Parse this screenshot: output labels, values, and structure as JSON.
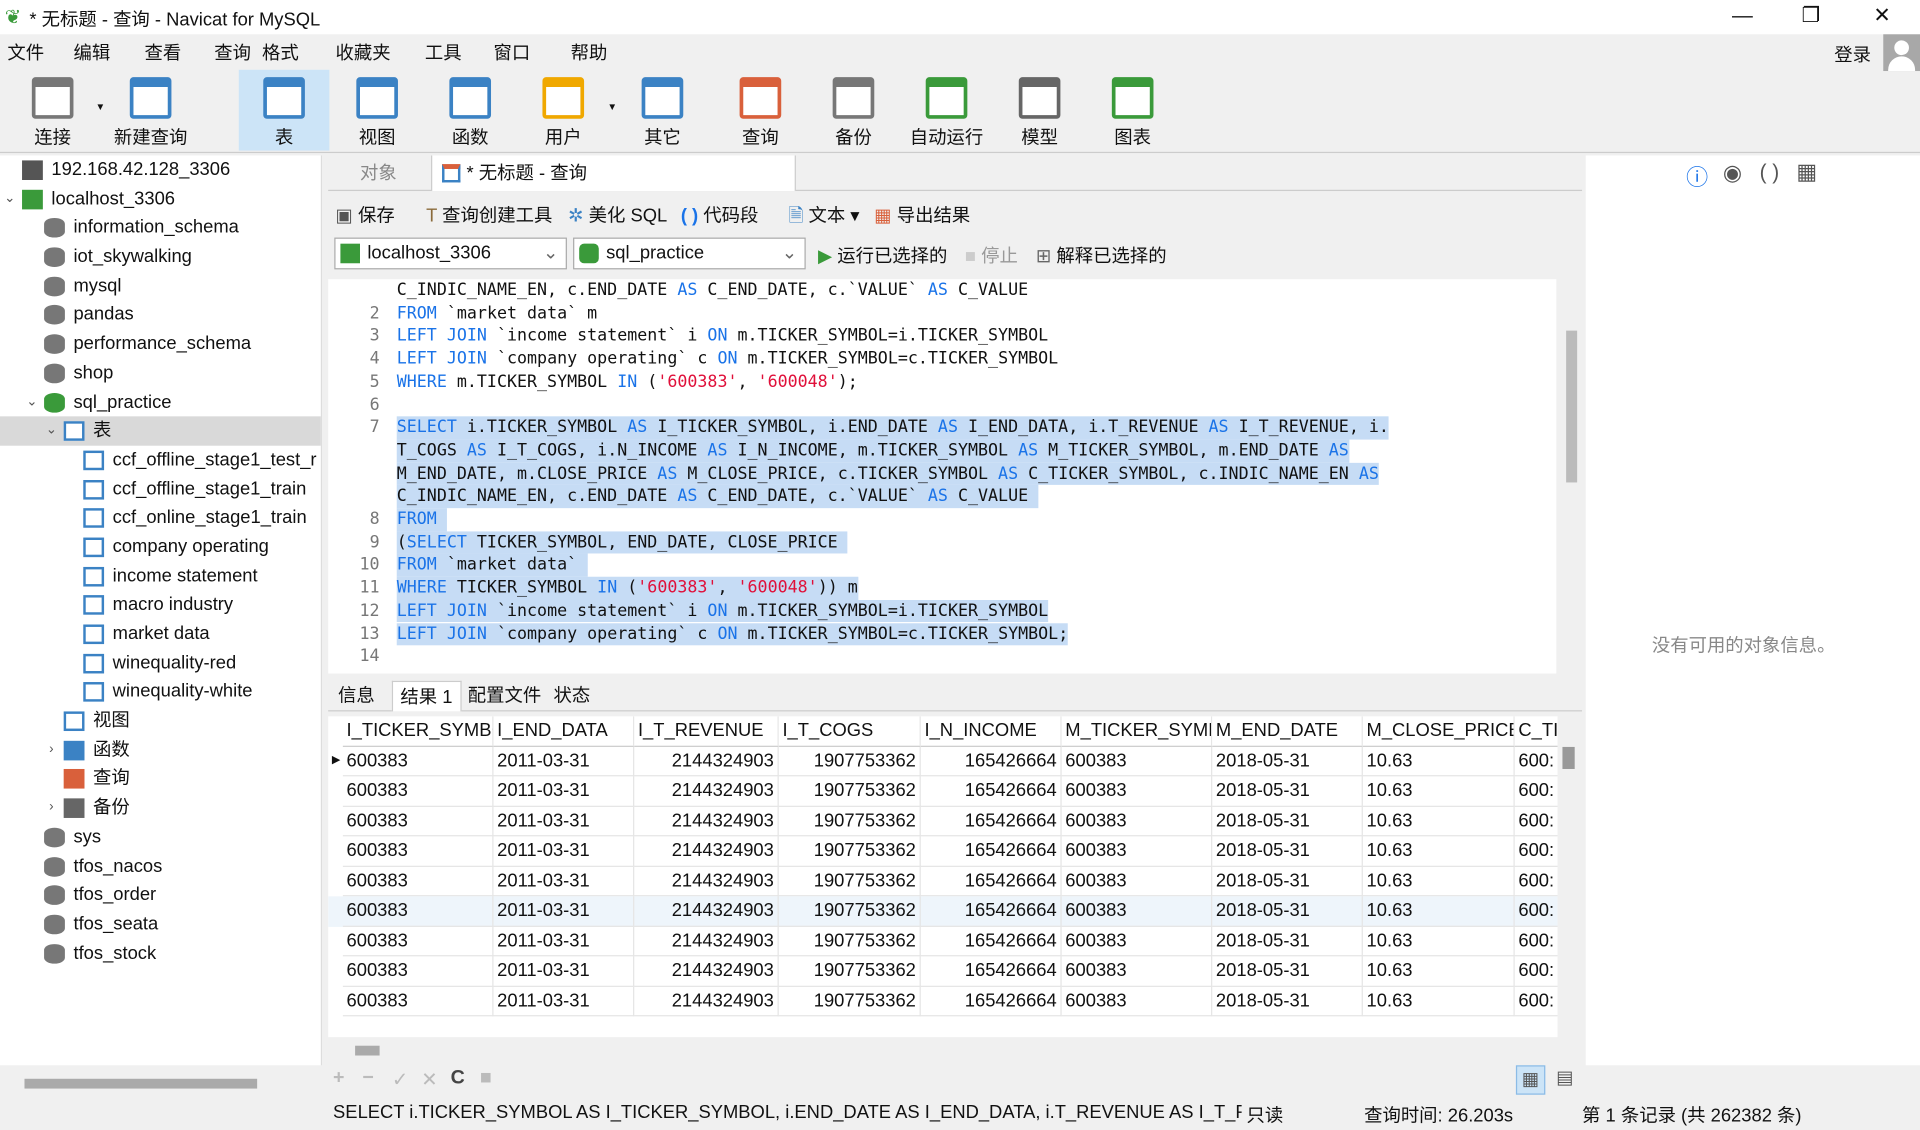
{
  "window": {
    "title": "* 无标题 - 查询 - Navicat for MySQL",
    "minimize": "—",
    "restore": "❐",
    "close": "✕"
  },
  "menu": [
    "文件",
    "编辑",
    "查看",
    "查询",
    "格式",
    "收藏夹",
    "工具",
    "窗口",
    "帮助"
  ],
  "login": "登录",
  "toolbar": [
    {
      "label": "连接",
      "icon": "plug-icon",
      "color": "#777"
    },
    {
      "label": "新建查询",
      "icon": "new-query-icon",
      "color": "#3b82c4"
    },
    {
      "label": "表",
      "icon": "table-icon",
      "color": "#3b82c4",
      "active": true
    },
    {
      "label": "视图",
      "icon": "view-icon",
      "color": "#3b82c4"
    },
    {
      "label": "函数",
      "icon": "function-icon",
      "color": "#3b82c4"
    },
    {
      "label": "用户",
      "icon": "user-icon",
      "color": "#f0a800"
    },
    {
      "label": "其它",
      "icon": "tools-icon",
      "color": "#3b82c4"
    },
    {
      "label": "查询",
      "icon": "query-icon",
      "color": "#d9603b"
    },
    {
      "label": "备份",
      "icon": "backup-icon",
      "color": "#777"
    },
    {
      "label": "自动运行",
      "icon": "schedule-icon",
      "color": "#3a9a3a"
    },
    {
      "label": "模型",
      "icon": "model-icon",
      "color": "#666"
    },
    {
      "label": "图表",
      "icon": "chart-icon",
      "color": "#3a9a3a"
    }
  ],
  "tree": [
    {
      "label": "192.168.42.128_3306",
      "level": 0,
      "icon": "server-icon",
      "arrow": ""
    },
    {
      "label": "localhost_3306",
      "level": 0,
      "icon": "server-connected-icon",
      "arrow": "v"
    },
    {
      "label": "information_schema",
      "level": 1,
      "icon": "database-icon"
    },
    {
      "label": "iot_skywalking",
      "level": 1,
      "icon": "database-icon"
    },
    {
      "label": "mysql",
      "level": 1,
      "icon": "database-icon"
    },
    {
      "label": "pandas",
      "level": 1,
      "icon": "database-icon"
    },
    {
      "label": "performance_schema",
      "level": 1,
      "icon": "database-icon"
    },
    {
      "label": "shop",
      "level": 1,
      "icon": "database-icon"
    },
    {
      "label": "sql_practice",
      "level": 1,
      "icon": "database-open-icon",
      "arrow": "v"
    },
    {
      "label": "表",
      "level": 2,
      "icon": "table-icon",
      "arrow": "v",
      "selected": true
    },
    {
      "label": "ccf_offline_stage1_test_r",
      "level": 3,
      "icon": "table-icon"
    },
    {
      "label": "ccf_offline_stage1_train",
      "level": 3,
      "icon": "table-icon"
    },
    {
      "label": "ccf_online_stage1_train",
      "level": 3,
      "icon": "table-icon"
    },
    {
      "label": "company operating",
      "level": 3,
      "icon": "table-icon"
    },
    {
      "label": "income statement",
      "level": 3,
      "icon": "table-icon"
    },
    {
      "label": "macro industry",
      "level": 3,
      "icon": "table-icon"
    },
    {
      "label": "market data",
      "level": 3,
      "icon": "table-icon"
    },
    {
      "label": "winequality-red",
      "level": 3,
      "icon": "table-icon"
    },
    {
      "label": "winequality-white",
      "level": 3,
      "icon": "table-icon"
    },
    {
      "label": "视图",
      "level": 2,
      "icon": "view-icon"
    },
    {
      "label": "函数",
      "level": 2,
      "icon": "function-icon",
      "arrow": ">"
    },
    {
      "label": "查询",
      "level": 2,
      "icon": "query-icon"
    },
    {
      "label": "备份",
      "level": 2,
      "icon": "backup-icon",
      "arrow": ">"
    },
    {
      "label": "sys",
      "level": 1,
      "icon": "database-icon"
    },
    {
      "label": "tfos_nacos",
      "level": 1,
      "icon": "database-icon"
    },
    {
      "label": "tfos_order",
      "level": 1,
      "icon": "database-icon"
    },
    {
      "label": "tfos_seata",
      "level": 1,
      "icon": "database-icon"
    },
    {
      "label": "tfos_stock",
      "level": 1,
      "icon": "database-icon"
    }
  ],
  "tabs": {
    "objects": "对象",
    "query": "* 无标题 - 查询"
  },
  "query_toolbar": {
    "save": "保存",
    "builder": "查询创建工具",
    "beautify": "美化 SQL",
    "snippet": "代码段",
    "text": "文本",
    "export": "导出结果"
  },
  "selectors": {
    "connection": "localhost_3306",
    "database": "sql_practice",
    "run_selected": "运行已选择的",
    "stop": "停止",
    "explain": "解释已选择的"
  },
  "editor": [
    {
      "n": "",
      "s": false,
      "tk": [
        [
          "C_INDIC_NAME_EN, c.END_DATE ",
          ""
        ],
        [
          "AS",
          "kw"
        ],
        [
          " C_END_DATE, c.`VALUE` ",
          ""
        ],
        [
          "AS",
          "kw"
        ],
        [
          " C_VALUE",
          ""
        ]
      ]
    },
    {
      "n": "2",
      "s": false,
      "tk": [
        [
          "FROM",
          "kw"
        ],
        [
          " `market data` m",
          ""
        ]
      ]
    },
    {
      "n": "3",
      "s": false,
      "tk": [
        [
          "LEFT JOIN",
          "kw"
        ],
        [
          " `income statement` i ",
          ""
        ],
        [
          "ON",
          "kw"
        ],
        [
          " m.TICKER_SYMBOL=i.TICKER_SYMBOL",
          ""
        ]
      ]
    },
    {
      "n": "4",
      "s": false,
      "tk": [
        [
          "LEFT JOIN",
          "kw"
        ],
        [
          " `company operating` c ",
          ""
        ],
        [
          "ON",
          "kw"
        ],
        [
          " m.TICKER_SYMBOL=c.TICKER_SYMBOL",
          ""
        ]
      ]
    },
    {
      "n": "5",
      "s": false,
      "tk": [
        [
          "WHERE",
          "kw"
        ],
        [
          " m.TICKER_SYMBOL ",
          ""
        ],
        [
          "IN",
          "kw"
        ],
        [
          " (",
          ""
        ],
        [
          "'600383'",
          "str"
        ],
        [
          ", ",
          ""
        ],
        [
          "'600048'",
          "str"
        ],
        [
          ");",
          ""
        ]
      ]
    },
    {
      "n": "6",
      "s": false,
      "tk": []
    },
    {
      "n": "7",
      "s": true,
      "tk": [
        [
          "SELECT",
          "kw"
        ],
        [
          " i.TICKER_SYMBOL ",
          ""
        ],
        [
          "AS",
          "kw"
        ],
        [
          " I_TICKER_SYMBOL, i.END_DATE ",
          ""
        ],
        [
          "AS",
          "kw"
        ],
        [
          " I_END_DATA, i.T_REVENUE ",
          ""
        ],
        [
          "AS",
          "kw"
        ],
        [
          " I_T_REVENUE, i.",
          ""
        ]
      ]
    },
    {
      "n": "",
      "s": true,
      "tk": [
        [
          "T_COGS ",
          ""
        ],
        [
          "AS",
          "kw"
        ],
        [
          " I_T_COGS, i.N_INCOME ",
          ""
        ],
        [
          "AS",
          "kw"
        ],
        [
          " I_N_INCOME, m.TICKER_SYMBOL ",
          ""
        ],
        [
          "AS",
          "kw"
        ],
        [
          " M_TICKER_SYMBOL, m.END_DATE ",
          ""
        ],
        [
          "AS",
          "kw"
        ]
      ]
    },
    {
      "n": "",
      "s": true,
      "tk": [
        [
          "M_END_DATE, m.CLOSE_PRICE ",
          ""
        ],
        [
          "AS",
          "kw"
        ],
        [
          " M_CLOSE_PRICE, c.TICKER_SYMBOL ",
          ""
        ],
        [
          "AS",
          "kw"
        ],
        [
          " C_TICKER_SYMBOL, c.INDIC_NAME_EN ",
          ""
        ],
        [
          "AS",
          "kw"
        ]
      ]
    },
    {
      "n": "",
      "s": true,
      "tk": [
        [
          "C_INDIC_NAME_EN, c.END_DATE ",
          ""
        ],
        [
          "AS",
          "kw"
        ],
        [
          " C_END_DATE, c.`VALUE` ",
          ""
        ],
        [
          "AS",
          "kw"
        ],
        [
          " C_VALUE ",
          ""
        ]
      ]
    },
    {
      "n": "8",
      "s": true,
      "tk": [
        [
          "FROM",
          "kw"
        ],
        [
          " ",
          ""
        ]
      ]
    },
    {
      "n": "9",
      "s": true,
      "tk": [
        [
          "(",
          ""
        ],
        [
          "SELECT",
          "kw"
        ],
        [
          " TICKER_SYMBOL, END_DATE, CLOSE_PRICE ",
          ""
        ]
      ]
    },
    {
      "n": "10",
      "s": true,
      "tk": [
        [
          "FROM",
          "kw"
        ],
        [
          " `market data` ",
          ""
        ]
      ]
    },
    {
      "n": "11",
      "s": true,
      "tk": [
        [
          "WHERE",
          "kw"
        ],
        [
          " TICKER_SYMBOL ",
          ""
        ],
        [
          "IN",
          "kw"
        ],
        [
          " (",
          ""
        ],
        [
          "'600383'",
          "str"
        ],
        [
          ", ",
          ""
        ],
        [
          "'600048'",
          "str"
        ],
        [
          ")) m",
          ""
        ]
      ]
    },
    {
      "n": "12",
      "s": true,
      "tk": [
        [
          "LEFT JOIN",
          "kw"
        ],
        [
          " `income statement` i ",
          ""
        ],
        [
          "ON",
          "kw"
        ],
        [
          " m.TICKER_SYMBOL=i.TICKER_SYMBOL",
          ""
        ]
      ]
    },
    {
      "n": "13",
      "s": true,
      "tk": [
        [
          "LEFT JOIN",
          "kw"
        ],
        [
          " `company operating` c ",
          ""
        ],
        [
          "ON",
          "kw"
        ],
        [
          " m.TICKER_SYMBOL=c.TICKER_SYMBOL;",
          ""
        ]
      ]
    },
    {
      "n": "14",
      "s": false,
      "tk": []
    }
  ],
  "result_tabs": [
    "信息",
    "结果 1",
    "配置文件",
    "状态"
  ],
  "grid": {
    "columns": [
      "I_TICKER_SYMBO",
      "I_END_DATA",
      "I_T_REVENUE",
      "I_T_COGS",
      "I_N_INCOME",
      "M_TICKER_SYMB",
      "M_END_DATE",
      "M_CLOSE_PRICE",
      "C_TI"
    ],
    "rows": [
      [
        "600383",
        "2011-03-31",
        "2144324903",
        "1907753362",
        "165426664",
        "600383",
        "2018-05-31",
        "10.63",
        "600:"
      ],
      [
        "600383",
        "2011-03-31",
        "2144324903",
        "1907753362",
        "165426664",
        "600383",
        "2018-05-31",
        "10.63",
        "600:"
      ],
      [
        "600383",
        "2011-03-31",
        "2144324903",
        "1907753362",
        "165426664",
        "600383",
        "2018-05-31",
        "10.63",
        "600:"
      ],
      [
        "600383",
        "2011-03-31",
        "2144324903",
        "1907753362",
        "165426664",
        "600383",
        "2018-05-31",
        "10.63",
        "600:"
      ],
      [
        "600383",
        "2011-03-31",
        "2144324903",
        "1907753362",
        "165426664",
        "600383",
        "2018-05-31",
        "10.63",
        "600:"
      ],
      [
        "600383",
        "2011-03-31",
        "2144324903",
        "1907753362",
        "165426664",
        "600383",
        "2018-05-31",
        "10.63",
        "600:"
      ],
      [
        "600383",
        "2011-03-31",
        "2144324903",
        "1907753362",
        "165426664",
        "600383",
        "2018-05-31",
        "10.63",
        "600:"
      ],
      [
        "600383",
        "2011-03-31",
        "2144324903",
        "1907753362",
        "165426664",
        "600383",
        "2018-05-31",
        "10.63",
        "600:"
      ],
      [
        "600383",
        "2011-03-31",
        "2144324903",
        "1907753362",
        "165426664",
        "600383",
        "2018-05-31",
        "10.63",
        "600:"
      ]
    ]
  },
  "grid_tools": [
    "+",
    "−",
    "✓",
    "✕",
    "C",
    "■"
  ],
  "right_panel": {
    "empty": "没有可用的对象信息。"
  },
  "status": {
    "sql": "SELECT i.TICKER_SYMBOL AS I_TICKER_SYMBOL, i.END_DATE AS I_END_DATA, i.T_REVENUE AS I_T_REVEN",
    "readonly": "只读",
    "time": "查询时间: 26.203s",
    "records": "第 1 条记录 (共 262382 条)"
  }
}
